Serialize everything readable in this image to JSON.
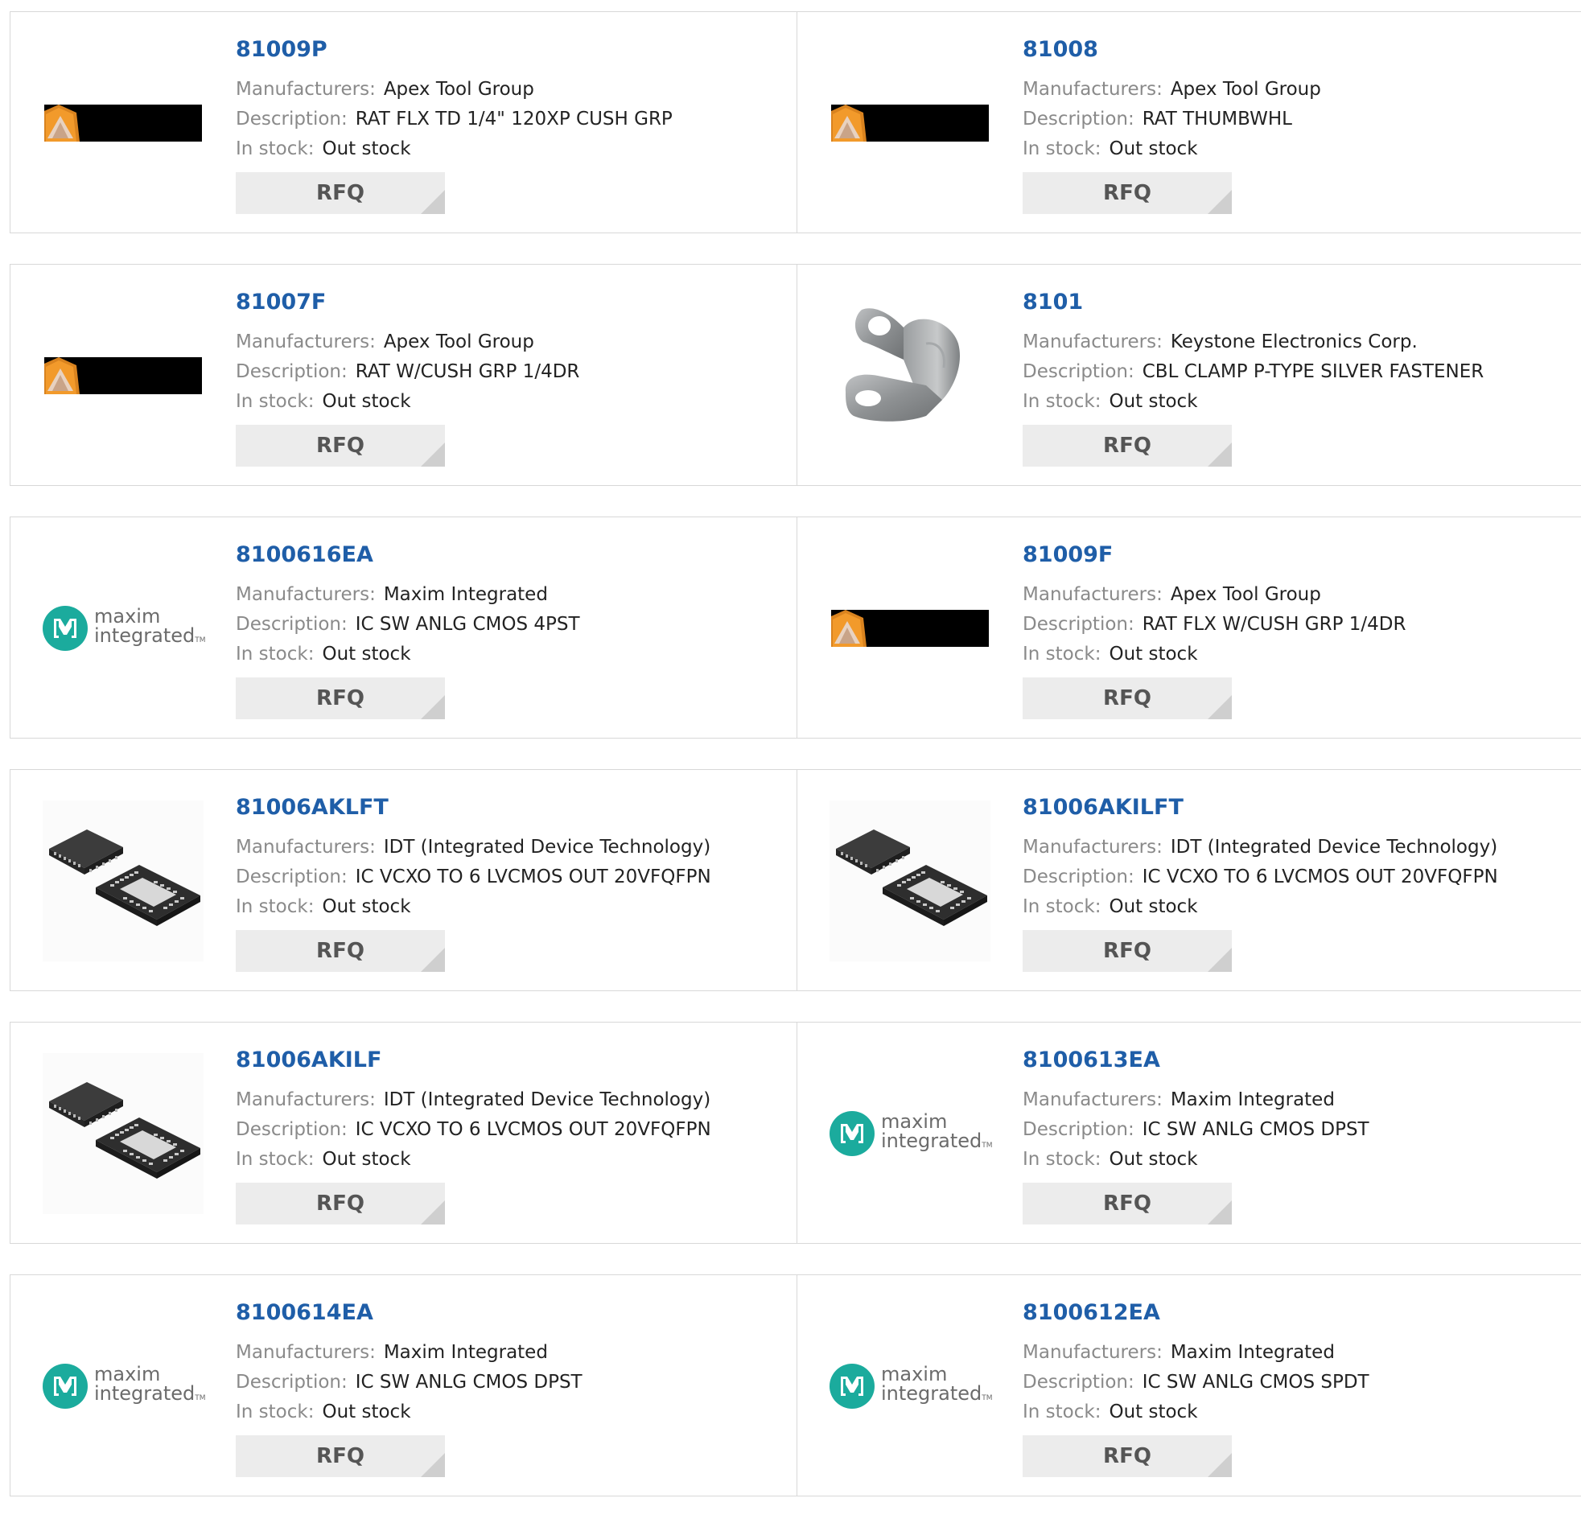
{
  "labels": {
    "manufacturer": "Manufacturers:",
    "description": "Description:",
    "stock": "In stock:",
    "rfq": "RFQ"
  },
  "colors": {
    "link": "#1f5ea8",
    "label": "#8a8a8a",
    "value": "#222222",
    "button_bg": "#ececec",
    "maxim_teal": "#1bab9d"
  },
  "products": [
    {
      "part": "81009P",
      "manufacturer": "Apex Tool Group",
      "description": "RAT FLX TD 1/4\" 120XP CUSH GRP",
      "stock": "Out stock",
      "image": "apex-tool-group-logo"
    },
    {
      "part": "81008",
      "manufacturer": "Apex Tool Group",
      "description": "RAT THUMBWHL",
      "stock": "Out stock",
      "image": "apex-tool-group-logo"
    },
    {
      "part": "81007F",
      "manufacturer": "Apex Tool Group",
      "description": "RAT W/CUSH GRP 1/4DR",
      "stock": "Out stock",
      "image": "apex-tool-group-logo"
    },
    {
      "part": "8101",
      "manufacturer": "Keystone Electronics Corp.",
      "description": "CBL CLAMP P-TYPE SILVER FASTENER",
      "stock": "Out stock",
      "image": "cable-clamp-photo"
    },
    {
      "part": "8100616EA",
      "manufacturer": "Maxim Integrated",
      "description": "IC SW ANLG CMOS 4PST",
      "stock": "Out stock",
      "image": "maxim-integrated-logo"
    },
    {
      "part": "81009F",
      "manufacturer": "Apex Tool Group",
      "description": "RAT FLX W/CUSH GRP 1/4DR",
      "stock": "Out stock",
      "image": "apex-tool-group-logo"
    },
    {
      "part": "81006AKLFT",
      "manufacturer": "IDT (Integrated Device Technology)",
      "description": "IC VCXO TO 6 LVCMOS OUT 20VFQFPN",
      "stock": "Out stock",
      "image": "qfn-chip-photo"
    },
    {
      "part": "81006AKILFT",
      "manufacturer": "IDT (Integrated Device Technology)",
      "description": "IC VCXO TO 6 LVCMOS OUT 20VFQFPN",
      "stock": "Out stock",
      "image": "qfn-chip-photo"
    },
    {
      "part": "81006AKILF",
      "manufacturer": "IDT (Integrated Device Technology)",
      "description": "IC VCXO TO 6 LVCMOS OUT 20VFQFPN",
      "stock": "Out stock",
      "image": "qfn-chip-photo"
    },
    {
      "part": "8100613EA",
      "manufacturer": "Maxim Integrated",
      "description": "IC SW ANLG CMOS DPST",
      "stock": "Out stock",
      "image": "maxim-integrated-logo"
    },
    {
      "part": "8100614EA",
      "manufacturer": "Maxim Integrated",
      "description": "IC SW ANLG CMOS DPST",
      "stock": "Out stock",
      "image": "maxim-integrated-logo"
    },
    {
      "part": "8100612EA",
      "manufacturer": "Maxim Integrated",
      "description": "IC SW ANLG CMOS SPDT",
      "stock": "Out stock",
      "image": "maxim-integrated-logo"
    }
  ],
  "maxim_logo_text": {
    "line1": "maxim",
    "line2": "integrated",
    "tm": "TM"
  }
}
